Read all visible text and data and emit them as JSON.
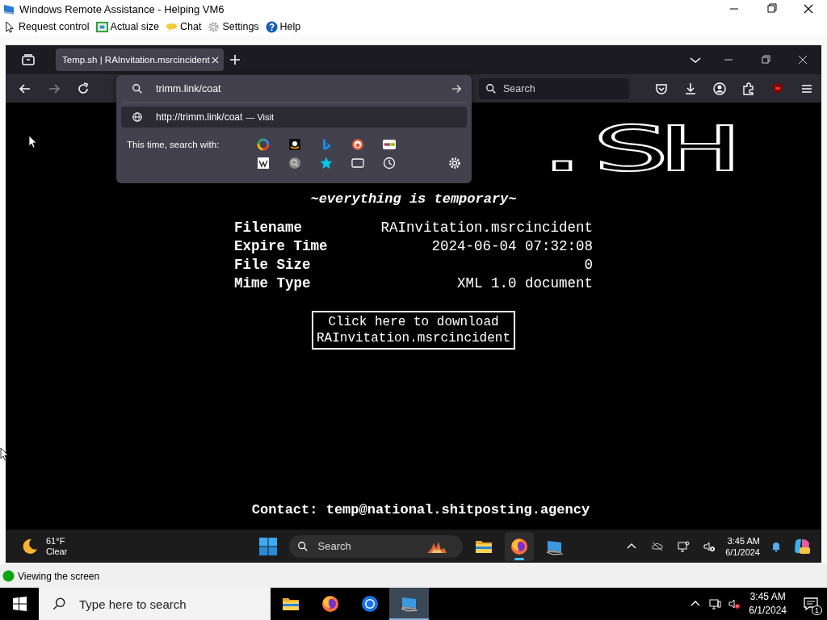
{
  "window": {
    "title": "Windows Remote Assistance - Helping VM6"
  },
  "toolbar": [
    {
      "label": "Request control",
      "kind": "cursor"
    },
    {
      "label": "Actual size",
      "kind": "resize"
    },
    {
      "label": "Chat",
      "kind": "chat"
    },
    {
      "label": "Settings",
      "kind": "gear"
    },
    {
      "label": "Help",
      "kind": "help"
    }
  ],
  "remote": {
    "browser": {
      "tabs": [
        {
          "label": "Temp.sh | RAInvitation.msrcincident",
          "selected": true
        }
      ],
      "forward_disabled": true,
      "search": {
        "placeholder": "Search"
      }
    },
    "dropdown": {
      "address": {
        "value": "trimm.link/coat"
      },
      "suggestion": {
        "url": "http://trimm.link/coat",
        "action": "— Visit"
      },
      "search_with": "This time, search with:",
      "engines": [
        {
          "kind": "google"
        },
        {
          "kind": "amazon"
        },
        {
          "kind": "bing"
        },
        {
          "kind": "duckduckgo"
        },
        {
          "kind": "ebay"
        },
        {
          "kind": "wikipedia"
        },
        {
          "kind": "search"
        },
        {
          "kind": "bookmarks"
        },
        {
          "kind": "tabs"
        },
        {
          "kind": "history"
        }
      ]
    },
    "page": {
      "logo": ".SH",
      "tagline": "~everything is temporary~",
      "fields": [
        {
          "label": "Filename",
          "value": "RAInvitation.msrcincident"
        },
        {
          "label": "Expire Time",
          "value": "2024-06-04 07:32:08"
        },
        {
          "label": "File Size",
          "value": "0"
        },
        {
          "label": "Mime Type",
          "value": "XML 1.0 document"
        }
      ],
      "download": [
        "Click here to download",
        "RAInvitation.msrcincident"
      ],
      "contact": "Contact: temp@national.shitposting.agency"
    },
    "taskbar": {
      "weather": {
        "temp": "61°F",
        "condition": "Clear"
      },
      "search": {
        "placeholder": "Search"
      },
      "apps": [
        {
          "kind": "explorer",
          "selected": false
        },
        {
          "kind": "firefox",
          "selected": true
        },
        {
          "kind": "remote",
          "selected": false
        }
      ],
      "time": "3:45 AM",
      "date": "6/1/2024"
    }
  },
  "status_bar": {
    "text": "Viewing the screen"
  },
  "taskbar": {
    "search": {
      "placeholder": "Type here to search"
    },
    "apps": [
      {
        "kind": "explorer",
        "selected": false
      },
      {
        "kind": "firefox",
        "selected": false
      },
      {
        "kind": "chrome",
        "selected": false
      },
      {
        "kind": "remote",
        "selected": true
      }
    ],
    "time": "3:45 AM",
    "date": "6/1/2024",
    "notifications": "1"
  }
}
